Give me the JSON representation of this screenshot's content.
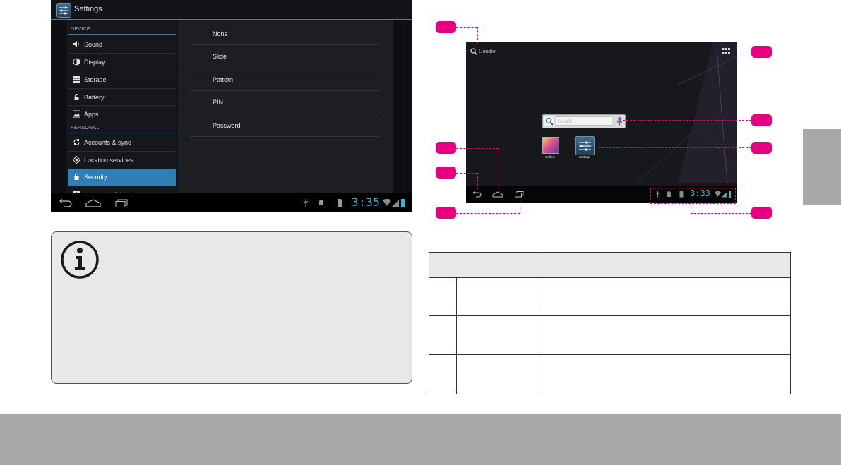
{
  "settings_screen": {
    "title": "Settings",
    "categories": [
      "DEVICE",
      "PERSONAL"
    ],
    "device_items": [
      {
        "label": "Sound",
        "icon": "volume-icon"
      },
      {
        "label": "Display",
        "icon": "brightness-icon"
      },
      {
        "label": "Storage",
        "icon": "storage-icon"
      },
      {
        "label": "Battery",
        "icon": "battery-icon"
      },
      {
        "label": "Apps",
        "icon": "apps-icon"
      }
    ],
    "personal_items": [
      {
        "label": "Accounts & sync",
        "icon": "sync-icon"
      },
      {
        "label": "Location services",
        "icon": "location-icon"
      },
      {
        "label": "Security",
        "icon": "lock-icon",
        "selected": true
      },
      {
        "label": "Language & input",
        "icon": "language-icon"
      }
    ],
    "lock_options": [
      "None",
      "Slide",
      "Pattern",
      "PIN",
      "Password"
    ],
    "clock": "3:35",
    "accent_color": "#2f7fb6"
  },
  "home_screen": {
    "search_label": "Google",
    "search_placeholder": "Google",
    "apps": [
      {
        "label": "Gallery",
        "icon": "gallery-icon"
      },
      {
        "label": "Settings",
        "icon": "settings-icon"
      }
    ],
    "clock": "3:33"
  },
  "colors": {
    "callout": "#e4007f",
    "note_bg": "#e8e8e8",
    "band": "#a8a8a8"
  }
}
